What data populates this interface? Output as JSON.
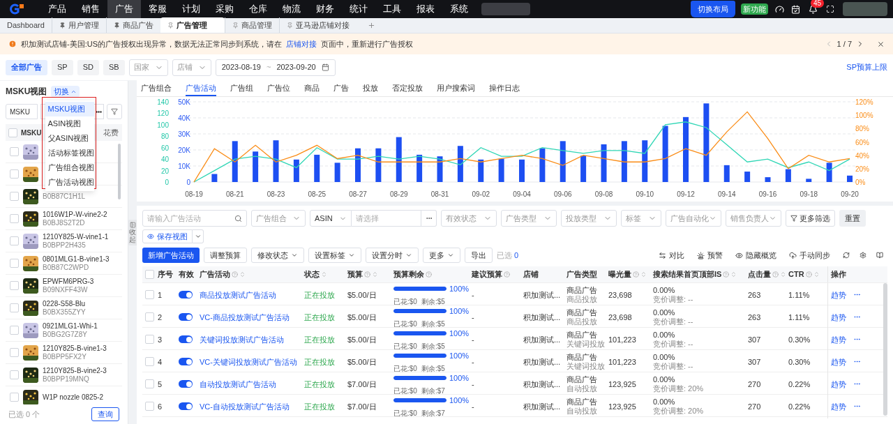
{
  "top_nav": {
    "items": [
      {
        "label": "产品",
        "selected": false
      },
      {
        "label": "销售",
        "selected": false
      },
      {
        "label": "广告",
        "selected": true
      },
      {
        "label": "客服",
        "selected": false
      },
      {
        "label": "计划",
        "selected": false
      },
      {
        "label": "采购",
        "selected": false
      },
      {
        "label": "仓库",
        "selected": false
      },
      {
        "label": "物流",
        "selected": false
      },
      {
        "label": "财务",
        "selected": false
      },
      {
        "label": "统计",
        "selected": false
      },
      {
        "label": "工具",
        "selected": false
      },
      {
        "label": "报表",
        "selected": false
      },
      {
        "label": "系统",
        "selected": false
      }
    ],
    "layout_button": "切换布局",
    "new_badge": "新功能",
    "notification_count": "45"
  },
  "tabs": [
    {
      "label": "Dashboard",
      "kind": "fixed",
      "selected": false
    },
    {
      "label": "用户管理",
      "kind": "pinned",
      "selected": false
    },
    {
      "label": "商品广告",
      "kind": "pinned",
      "selected": false
    },
    {
      "label": "广告管理",
      "kind": "unpinned",
      "selected": true
    },
    {
      "label": "商品管理",
      "kind": "unpinned",
      "selected": false
    },
    {
      "label": "亚马逊店铺对接",
      "kind": "unpinned",
      "selected": false
    }
  ],
  "notice": {
    "text_before": "积加测试店铺-美国:US的广告授权出现异常，数据无法正常同步到系统，请在",
    "link": "店铺对接",
    "text_after": "页面中，重新进行广告授权",
    "pager": "1 / 7"
  },
  "ad_types": [
    {
      "label": "全部广告",
      "selected": true
    },
    {
      "label": "SP",
      "selected": false
    },
    {
      "label": "SD",
      "selected": false
    },
    {
      "label": "SB",
      "selected": false
    }
  ],
  "filters": {
    "country": "国家",
    "store": "店铺",
    "date_from": "2023-08-19",
    "date_sep": "~",
    "date_to": "2023-09-20"
  },
  "budget_link": "SP预算上限",
  "left_panel": {
    "title": "MSKU视图",
    "switch": "切换",
    "switch_expanded": true,
    "field_select": "MSKU",
    "header_col1": "MSKU",
    "header_col2": "花费",
    "all_checked": false,
    "view_menu": [
      {
        "label": "MSKU视图",
        "selected": true
      },
      {
        "label": "ASIN视图",
        "selected": false
      },
      {
        "label": "父ASIN视图",
        "selected": false
      },
      {
        "label": "活动标签视图",
        "selected": false
      },
      {
        "label": "广告组合视图",
        "selected": false
      },
      {
        "label": "广告活动视图",
        "selected": false
      }
    ],
    "items": [
      {
        "checked": false
      },
      {
        "checked": false
      },
      {
        "asin": "B0B87C1H1L",
        "checked": false
      },
      {
        "sku": "1016W1P-W-vine2-2",
        "asin": "B0BJ8S2T2D",
        "checked": false
      },
      {
        "sku": "1210Y825-W-vine1-1",
        "asin": "B0BPP2H435",
        "checked": false
      },
      {
        "sku": "0801MLG1-B-vine1-3",
        "asin": "B0B87C2WPD",
        "checked": false
      },
      {
        "sku": "EPWFM6PRG-3",
        "asin": "B09NXFF43W",
        "checked": false
      },
      {
        "sku": "0228-S58-Blu",
        "asin": "B0BX355ZYY",
        "checked": false
      },
      {
        "sku": "0921MLG1-Whi-1",
        "asin": "B0BG2G7Z8Y",
        "checked": false
      },
      {
        "sku": "1210Y825-B-vine1-3",
        "asin": "B0BPP5FX2Y",
        "checked": false
      },
      {
        "sku": "1210Y825-B-vine2-3",
        "asin": "B0BPP19MNQ",
        "checked": false
      },
      {
        "sku": "W1P nozzle 0825-2",
        "checked": false
      }
    ],
    "selected_count": "已选 0 个",
    "query_button": "查询"
  },
  "collapse": "收起",
  "sub_tabs": [
    {
      "label": "广告组合",
      "selected": false
    },
    {
      "label": "广告活动",
      "selected": true
    },
    {
      "label": "广告组",
      "selected": false
    },
    {
      "label": "广告位",
      "selected": false
    },
    {
      "label": "商品",
      "selected": false
    },
    {
      "label": "广告",
      "selected": false
    },
    {
      "label": "投放",
      "selected": false
    },
    {
      "label": "否定投放",
      "selected": false
    },
    {
      "label": "用户搜索词",
      "selected": false
    },
    {
      "label": "操作日志",
      "selected": false
    }
  ],
  "chart_data": {
    "type": "bar",
    "grid": true,
    "categories": [
      "08-19",
      null,
      "08-21",
      null,
      "08-23",
      null,
      "08-25",
      null,
      "08-27",
      null,
      "08-29",
      null,
      "08-31",
      null,
      "09-02",
      null,
      "09-04",
      null,
      "09-06",
      null,
      "09-08",
      null,
      "09-10",
      null,
      "09-12",
      null,
      "09-14",
      null,
      "09-16",
      null,
      "09-18",
      null,
      "09-20"
    ],
    "ylim": [
      0,
      50000
    ],
    "yticks": [
      {
        "value": 0,
        "label": "0"
      },
      {
        "value": 10000,
        "label": "10K"
      },
      {
        "value": 20000,
        "label": "20K"
      },
      {
        "value": 30000,
        "label": "30K"
      },
      {
        "value": 40000,
        "label": "40K"
      },
      {
        "value": 50000,
        "label": "50K"
      }
    ],
    "y2lim": [
      0,
      140
    ],
    "y2ticks": [
      0,
      20,
      40,
      60,
      80,
      100,
      120,
      140
    ],
    "y3lim": [
      0,
      120
    ],
    "y3ticks": [
      {
        "value": 0,
        "label": "0%"
      },
      {
        "value": 20,
        "label": "20%"
      },
      {
        "value": 40,
        "label": "40%"
      },
      {
        "value": 60,
        "label": "60%"
      },
      {
        "value": 80,
        "label": "80%"
      },
      {
        "value": 100,
        "label": "100%"
      },
      {
        "value": 120,
        "label": "120%"
      }
    ],
    "series": [
      {
        "color": "#1d4ff2",
        "values": [
          0,
          5000,
          25500,
          19000,
          26000,
          14000,
          17000,
          12000,
          21000,
          21000,
          28000,
          17000,
          16000,
          22500,
          14000,
          14500,
          14000,
          21000,
          25500,
          16500,
          23500,
          25500,
          26000,
          35000,
          40500,
          49000,
          10500,
          6500,
          3000,
          8000,
          2000,
          12000,
          4000
        ]
      },
      {
        "type": "line",
        "axis": "y2",
        "color": "#2fd6b5",
        "values": [
          0,
          20,
          40,
          45,
          40,
          25,
          60,
          40,
          40,
          45,
          40,
          45,
          40,
          30,
          60,
          45,
          45,
          60,
          55,
          50,
          55,
          55,
          50,
          100,
          105,
          95,
          65,
          35,
          40,
          25,
          35,
          20,
          40
        ]
      },
      {
        "type": "line",
        "axis": "y3",
        "color": "#fa8c16",
        "values": [
          0,
          50,
          30,
          55,
          30,
          40,
          55,
          35,
          40,
          30,
          30,
          30,
          30,
          35,
          30,
          35,
          40,
          35,
          25,
          40,
          35,
          30,
          30,
          35,
          50,
          40,
          75,
          105,
          65,
          20,
          40,
          30,
          35
        ]
      }
    ]
  },
  "campaign_filters": {
    "search_placeholder": "请输入广告活动",
    "portfolio": "广告组合",
    "asin_field": "ASIN",
    "asin_placeholder": "请选择",
    "selects": [
      "有效状态",
      "广告类型",
      "投放类型",
      "标签",
      "广告自动化",
      "销售负责人"
    ],
    "more_filters": "更多筛选",
    "reset": "重置",
    "save_view": "保存视图"
  },
  "toolbar": {
    "add": "新增广告活动",
    "actions": [
      {
        "label": "调整预算",
        "dropdown": false
      },
      {
        "label": "修改状态",
        "dropdown": true
      },
      {
        "label": "设置标签",
        "dropdown": true
      },
      {
        "label": "设置分时",
        "dropdown": true
      },
      {
        "label": "更多",
        "dropdown": true
      },
      {
        "label": "导出",
        "dropdown": false
      }
    ],
    "selected_label": "已选",
    "selected_count": "0",
    "right": [
      {
        "label": "对比",
        "kind": "compare"
      },
      {
        "label": "预警",
        "kind": "alert"
      },
      {
        "label": "隐藏概览",
        "kind": "eye"
      },
      {
        "label": "手动同步",
        "kind": "sync"
      }
    ]
  },
  "table": {
    "all_checked": false,
    "columns": [
      {
        "label": "序号",
        "help": false,
        "sort": false
      },
      {
        "label": "有效",
        "help": false,
        "sort": false
      },
      {
        "label": "广告活动",
        "help": true,
        "sort": true
      },
      {
        "label": "状态",
        "help": false,
        "sort": true
      },
      {
        "label": "预算",
        "help": true,
        "sort": true
      },
      {
        "label": "预算剩余",
        "help": true,
        "sort": false
      },
      {
        "label": "建议预算",
        "help": true,
        "sort": false
      },
      {
        "label": "店铺",
        "help": false,
        "sort": false
      },
      {
        "label": "广告类型",
        "help": false,
        "sort": false
      },
      {
        "label": "曝光量",
        "help": true,
        "sort": true
      },
      {
        "label": "搜索结果首页顶部IS",
        "help": true,
        "sort": true
      },
      {
        "label": "点击量",
        "help": true,
        "sort": true
      },
      {
        "label": "CTR",
        "help": true,
        "sort": true
      },
      {
        "label": "操作",
        "help": false,
        "sort": false
      }
    ],
    "rows": [
      {
        "checked": false,
        "index": "1",
        "enabled": true,
        "name": "商品投放测试广告活动",
        "status": "正在投放",
        "budget": "$5.00/日",
        "level": 1,
        "percent": "100%",
        "spent": "已花:$0",
        "remaining": "剩余:$5",
        "suggested": "-",
        "store": "积加测试...",
        "type": "商品广告",
        "subtype": "商品投放",
        "impressions": "23,698",
        "top_is": "0.00%",
        "bid_adjust": "竞价调整: --",
        "clicks": "263",
        "ctr": "1.11%",
        "action": "趋势"
      },
      {
        "checked": false,
        "index": "2",
        "enabled": true,
        "name": "VC-商品投放测试广告活动",
        "status": "正在投放",
        "budget": "$5.00/日",
        "level": 1,
        "percent": "100%",
        "spent": "已花:$0",
        "remaining": "剩余:$5",
        "suggested": "-",
        "store": "积加测试...",
        "type": "商品广告",
        "subtype": "商品投放",
        "impressions": "23,698",
        "top_is": "0.00%",
        "bid_adjust": "竞价调整: --",
        "clicks": "263",
        "ctr": "1.11%",
        "action": "趋势"
      },
      {
        "checked": false,
        "index": "3",
        "enabled": true,
        "name": "关键词投放测试广告活动",
        "status": "正在投放",
        "budget": "$5.00/日",
        "level": 1,
        "percent": "100%",
        "spent": "已花:$0",
        "remaining": "剩余:$5",
        "suggested": "-",
        "store": "积加测试...",
        "type": "商品广告",
        "subtype": "关键词投放",
        "impressions": "101,223",
        "top_is": "0.00%",
        "bid_adjust": "竞价调整: --",
        "clicks": "307",
        "ctr": "0.30%",
        "action": "趋势"
      },
      {
        "checked": false,
        "index": "4",
        "enabled": true,
        "name": "VC-关键词投放测试广告活动",
        "status": "正在投放",
        "budget": "$5.00/日",
        "level": 1,
        "percent": "100%",
        "spent": "已花:$0",
        "remaining": "剩余:$5",
        "suggested": "-",
        "store": "积加测试...",
        "type": "商品广告",
        "subtype": "关键词投放",
        "impressions": "101,223",
        "top_is": "0.00%",
        "bid_adjust": "竞价调整: --",
        "clicks": "307",
        "ctr": "0.30%",
        "action": "趋势"
      },
      {
        "checked": false,
        "index": "5",
        "enabled": true,
        "name": "自动投放测试广告活动",
        "status": "正在投放",
        "budget": "$7.00/日",
        "level": 1,
        "percent": "100%",
        "spent": "已花:$0",
        "remaining": "剩余:$7",
        "suggested": "-",
        "store": "积加测试...",
        "type": "商品广告",
        "subtype": "自动投放",
        "impressions": "123,925",
        "top_is": "0.00%",
        "bid_adjust": "竞价调整: 20%",
        "clicks": "270",
        "ctr": "0.22%",
        "action": "趋势"
      },
      {
        "checked": false,
        "index": "6",
        "enabled": true,
        "name": "VC-自动投放测试广告活动",
        "status": "正在投放",
        "budget": "$7.00/日",
        "level": 1,
        "percent": "100%",
        "spent": "已花:$0",
        "remaining": "剩余:$7",
        "suggested": "-",
        "store": "积加测试...",
        "type": "商品广告",
        "subtype": "自动投放",
        "impressions": "123,925",
        "top_is": "0.00%",
        "bid_adjust": "竞价调整: 20%",
        "clicks": "270",
        "ctr": "0.22%",
        "action": "趋势"
      }
    ]
  }
}
